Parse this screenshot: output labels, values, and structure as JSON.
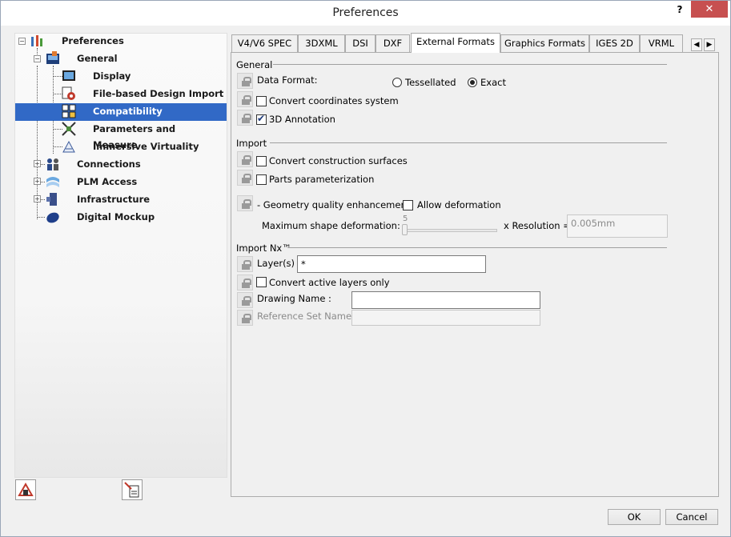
{
  "window": {
    "title": "Preferences",
    "help": "?",
    "close": "✕"
  },
  "tree": {
    "items": [
      {
        "label": "Preferences"
      },
      {
        "label": "General"
      },
      {
        "label": "Display"
      },
      {
        "label": "File-based Design Import"
      },
      {
        "label": "Compatibility"
      },
      {
        "label": "Parameters and Measure"
      },
      {
        "label": "Immersive Virtuality"
      },
      {
        "label": "Connections"
      },
      {
        "label": "PLM Access"
      },
      {
        "label": "Infrastructure"
      },
      {
        "label": "Digital Mockup"
      }
    ],
    "selected": "Compatibility"
  },
  "tabs": [
    {
      "label": "V4/V6 SPEC"
    },
    {
      "label": "3DXML"
    },
    {
      "label": "DSI"
    },
    {
      "label": "DXF"
    },
    {
      "label": "External Formats"
    },
    {
      "label": "Graphics Formats"
    },
    {
      "label": "IGES 2D"
    },
    {
      "label": "VRML"
    }
  ],
  "active_tab": "External Formats",
  "general": {
    "heading": "General",
    "data_format_label": "Data Format:",
    "tessellated": "Tessellated",
    "exact": "Exact",
    "convert_coords": "Convert coordinates system",
    "annotation_3d": "3D Annotation"
  },
  "import": {
    "heading": "Import",
    "convert_surfaces": "Convert construction surfaces",
    "parts_param": "Parts parameterization",
    "geom_quality": "- Geometry quality enhancement:",
    "allow_deformation": "Allow deformation",
    "max_shape": "Maximum shape deformation:",
    "slider_value": "5",
    "x_resolution": "x Resolution =",
    "resolution_value": "0.005mm"
  },
  "import_nx": {
    "heading": "Import Nx™",
    "layers_label": "Layer(s) :",
    "layers_value": "*",
    "convert_active": "Convert active layers only",
    "drawing_name_label": "Drawing Name :",
    "drawing_name_value": "",
    "reference_set_label": "Reference Set Name  :",
    "reference_set_value": ""
  },
  "buttons": {
    "ok": "OK",
    "cancel": "Cancel"
  }
}
